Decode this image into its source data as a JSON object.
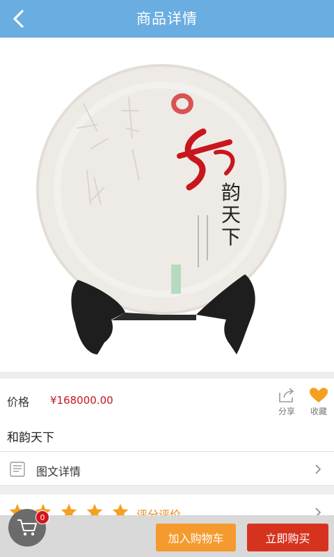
{
  "header": {
    "title": "商品详情",
    "back_icon": "chevron-left-icon"
  },
  "product": {
    "image_label": "和韵天下",
    "price_label": "价格",
    "price": "¥168000.00",
    "name": "和韵天下"
  },
  "actions": {
    "share_label": "分享",
    "favorite_label": "收藏",
    "favorite_color": "#f5a020"
  },
  "detail": {
    "label": "图文详情"
  },
  "rating": {
    "label": "评分评价",
    "stars": 5,
    "star_color": "#f5a020"
  },
  "bottom": {
    "cart_count": "0",
    "add_to_cart": "加入购物车",
    "buy_now": "立即购买"
  },
  "colors": {
    "header": "#6aade0",
    "price": "#c8161d",
    "add_to_cart": "#f59a2e",
    "buy_now": "#d6331f"
  }
}
